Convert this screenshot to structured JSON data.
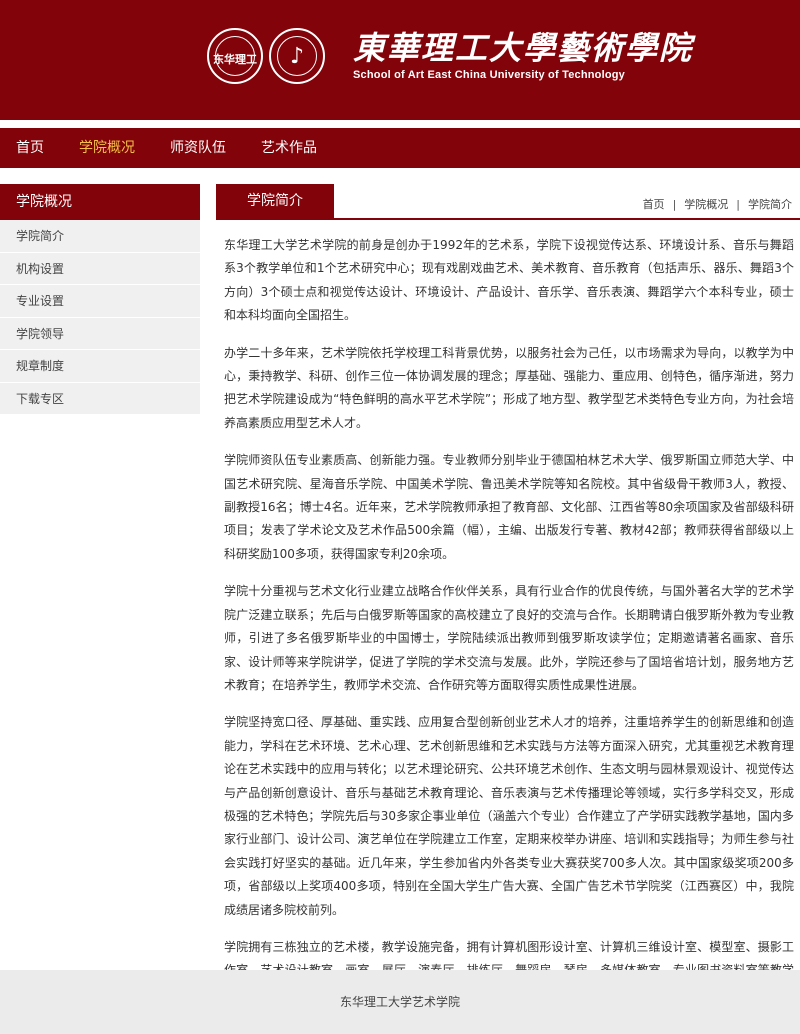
{
  "header": {
    "title_cn": "東華理工大學藝術學院",
    "title_en": "School of Art East China University of Technology",
    "emblem_text": "东华理工"
  },
  "nav": {
    "items": [
      {
        "label": "首页"
      },
      {
        "label": "学院概况"
      },
      {
        "label": "师资队伍"
      },
      {
        "label": "艺术作品"
      }
    ]
  },
  "sidebar": {
    "title": "学院概况",
    "items": [
      {
        "label": "学院简介"
      },
      {
        "label": "机构设置"
      },
      {
        "label": "专业设置"
      },
      {
        "label": "学院领导"
      },
      {
        "label": "规章制度"
      },
      {
        "label": "下载专区"
      }
    ]
  },
  "content": {
    "tab": "学院简介",
    "breadcrumb": [
      "首页",
      "学院概况",
      "学院简介"
    ],
    "breadcrumb_sep": "|",
    "paragraphs": [
      "东华理工大学艺术学院的前身是创办于1992年的艺术系，学院下设视觉传达系、环境设计系、音乐与舞蹈系3个教学单位和1个艺术研究中心；现有戏剧戏曲艺术、美术教育、音乐教育（包括声乐、器乐、舞蹈3个方向）3个硕士点和视觉传达设计、环境设计、产品设计、音乐学、音乐表演、舞蹈学六个本科专业，硕士和本科均面向全国招生。",
      "办学二十多年来，艺术学院依托学校理工科背景优势，以服务社会为己任，以市场需求为导向，以教学为中心，秉持教学、科研、创作三位一体协调发展的理念；厚基础、强能力、重应用、创特色，循序渐进，努力把艺术学院建设成为“特色鲜明的高水平艺术学院”；形成了地方型、教学型艺术类特色专业方向，为社会培养高素质应用型艺术人才。",
      "学院师资队伍专业素质高、创新能力强。专业教师分别毕业于德国柏林艺术大学、俄罗斯国立师范大学、中国艺术研究院、星海音乐学院、中国美术学院、鲁迅美术学院等知名院校。其中省级骨干教师3人，教授、副教授16名；博士4名。近年来，艺术学院教师承担了教育部、文化部、江西省等80余项国家及省部级科研项目；发表了学术论文及艺术作品500余篇（幅），主编、出版发行专著、教材42部；教师获得省部级以上科研奖励100多项，获得国家专利20余项。",
      " 学院十分重视与艺术文化行业建立战略合作伙伴关系，具有行业合作的优良传统，与国外著名大学的艺术学院广泛建立联系；先后与白俄罗斯等国家的高校建立了良好的交流与合作。长期聘请白俄罗斯外教为专业教师，引进了多名俄罗斯毕业的中国博士，学院陆续派出教师到俄罗斯攻读学位；定期邀请著名画家、音乐家、设计师等来学院讲学，促进了学院的学术交流与发展。此外，学院还参与了国培省培计划，服务地方艺术教育；在培养学生，教师学术交流、合作研究等方面取得实质性成果性进展。",
      "学院坚持宽口径、厚基础、重实践、应用复合型创新创业艺术人才的培养，注重培养学生的创新思维和创造能力，学科在艺术环境、艺术心理、艺术创新思维和艺术实践与方法等方面深入研究，尤其重视艺术教育理论在艺术实践中的应用与转化；以艺术理论研究、公共环境艺术创作、生态文明与园林景观设计、视觉传达与产品创新创意设计、音乐与基础艺术教育理论、音乐表演与艺术传播理论等领域，实行多学科交叉，形成极强的艺术特色；学院先后与30多家企事业单位（涵盖六个专业）合作建立了产学研实践教学基地，国内多家行业部门、设计公司、演艺单位在学院建立工作室，定期来校举办讲座、培训和实践指导；为师生参与社会实践打好坚实的基础。近几年来，学生参加省内外各类专业大赛获奖700多人次。其中国家级奖项200多项，省部级以上奖项400多项，特别在全国大学生广告大赛、全国广告艺术节学院奖（江西赛区）中，我院成绩居诸多院校前列。",
      "学院拥有三栋独立的艺术楼，教学设施完备，拥有计算机图形设计室、计算机三维设计室、模型室、摄影工作室、艺术设计教室、画室、展厅、演奏厅、排练厅、舞蹈房、琴房、多媒体教室、专业图书资料室等教学和实践场所，在上海、深圳、广州、温州等地建立了20多个就业、实习基地。近二十多年来，学院为国家输送了艺术类人才数千名，这些毕业生分别在高校、宣传部门、文化部门、广告公司、设计公司、表演团体、部队等单位就职，由于专业功底扎实，专业实践能力强，受到用人单位的广泛好评。"
    ]
  },
  "footer": {
    "text": "东华理工大学艺术学院"
  },
  "colors": {
    "brand": "#820309",
    "nav_active": "#f5c04a",
    "sidebar_bg": "#f0f0f0",
    "footer_bg": "#ebebeb"
  }
}
